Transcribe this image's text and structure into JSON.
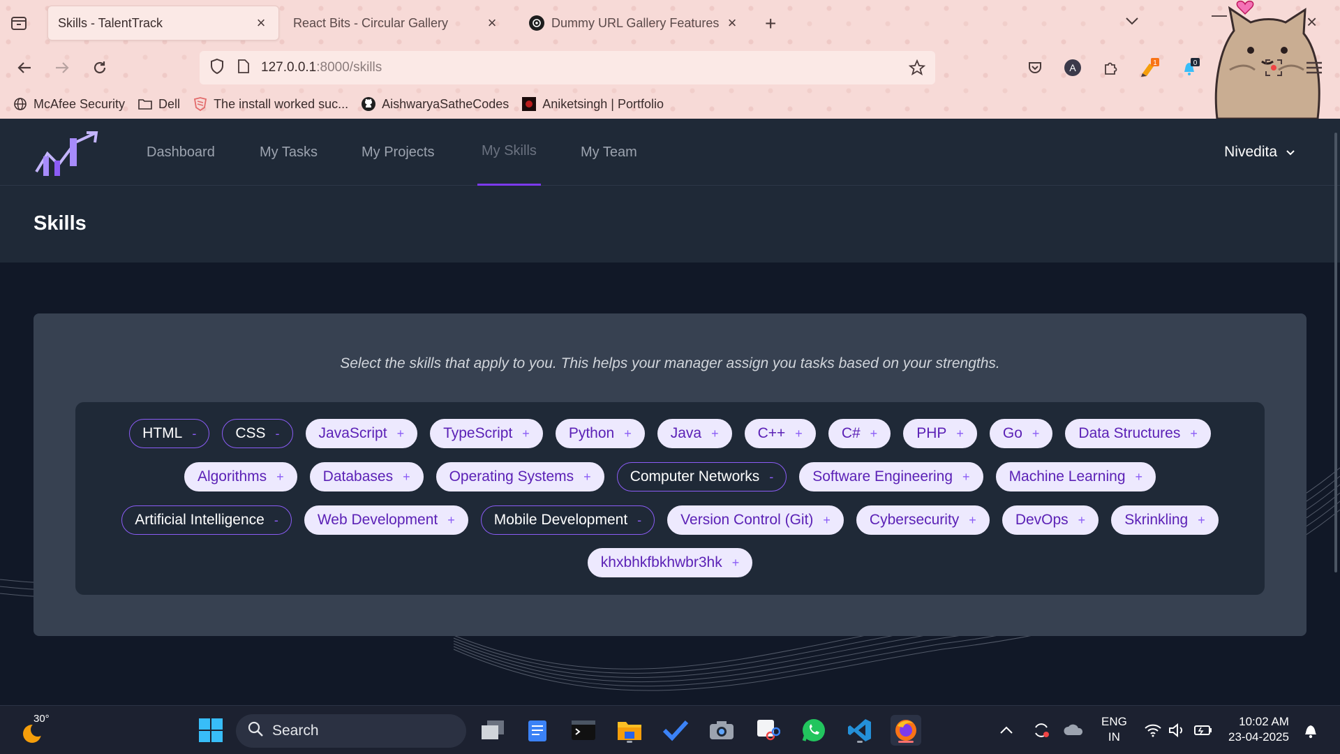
{
  "browser": {
    "tabs": [
      {
        "title": "Skills - TalentTrack",
        "active": true
      },
      {
        "title": "React Bits - Circular Gallery",
        "active": false
      },
      {
        "title": "Dummy URL Gallery Features",
        "active": false
      }
    ],
    "url_host": "127.0.0.1",
    "url_path": ":8000/skills",
    "extensions": [
      {
        "icon": "pocket-icon"
      },
      {
        "icon": "account-a-icon",
        "label": "A"
      },
      {
        "icon": "extensions-icon"
      },
      {
        "icon": "highlighter-icon",
        "badge": "1"
      },
      {
        "icon": "notification-extension-icon",
        "badge": "0"
      },
      {
        "icon": "ublock-icon"
      },
      {
        "icon": "screenshot-icon"
      },
      {
        "icon": "menu-icon"
      }
    ],
    "bookmarks": [
      {
        "label": "McAfee Security",
        "icon": "globe-icon"
      },
      {
        "label": "Dell",
        "icon": "folder-icon"
      },
      {
        "label": "The install worked suc...",
        "icon": "django-icon"
      },
      {
        "label": "AishwaryaSatheCodes",
        "icon": "github-icon"
      },
      {
        "label": "Aniketsingh | Portfolio",
        "icon": "portfolio-icon"
      }
    ]
  },
  "app": {
    "nav": [
      {
        "label": "Dashboard",
        "active": false
      },
      {
        "label": "My Tasks",
        "active": false
      },
      {
        "label": "My Projects",
        "active": false
      },
      {
        "label": "My Skills",
        "active": true
      },
      {
        "label": "My Team",
        "active": false
      }
    ],
    "user": "Nivedita",
    "page_title": "Skills",
    "intro": "Select the skills that apply to you. This helps your manager assign you tasks based on your strengths.",
    "skill_rows": [
      [
        {
          "name": "HTML",
          "selected": true
        },
        {
          "name": "CSS",
          "selected": true
        },
        {
          "name": "JavaScript",
          "selected": false
        },
        {
          "name": "TypeScript",
          "selected": false
        },
        {
          "name": "Python",
          "selected": false
        },
        {
          "name": "Java",
          "selected": false
        },
        {
          "name": "C++",
          "selected": false
        },
        {
          "name": "C#",
          "selected": false
        },
        {
          "name": "PHP",
          "selected": false
        },
        {
          "name": "Go",
          "selected": false
        },
        {
          "name": "Data Structures",
          "selected": false
        }
      ],
      [
        {
          "name": "Algorithms",
          "selected": false
        },
        {
          "name": "Databases",
          "selected": false
        },
        {
          "name": "Operating Systems",
          "selected": false
        },
        {
          "name": "Computer Networks",
          "selected": true
        },
        {
          "name": "Software Engineering",
          "selected": false
        },
        {
          "name": "Machine Learning",
          "selected": false
        }
      ],
      [
        {
          "name": "Artificial Intelligence",
          "selected": true
        },
        {
          "name": "Web Development",
          "selected": false
        },
        {
          "name": "Mobile Development",
          "selected": true
        },
        {
          "name": "Version Control (Git)",
          "selected": false
        },
        {
          "name": "Cybersecurity",
          "selected": false
        },
        {
          "name": "DevOps",
          "selected": false
        },
        {
          "name": "Skrinkling",
          "selected": false
        }
      ],
      [
        {
          "name": "khxbhkfbkhwbr3hk",
          "selected": false
        }
      ]
    ],
    "add_symbol": "+",
    "remove_symbol": "-",
    "colors": {
      "accent": "#8b5cf6",
      "chip_bg": "#ede9fe",
      "chip_text": "#5b21b6",
      "card": "#374151"
    }
  },
  "taskbar": {
    "temperature": "30°",
    "search_placeholder": "Search",
    "apps": [
      {
        "icon": "start-icon"
      },
      {
        "icon": "task-view-icon"
      },
      {
        "icon": "notepad-icon"
      },
      {
        "icon": "terminal-icon"
      },
      {
        "icon": "file-explorer-icon",
        "running": true
      },
      {
        "icon": "todo-icon"
      },
      {
        "icon": "camera-icon"
      },
      {
        "icon": "snipping-tool-icon"
      },
      {
        "icon": "whatsapp-icon"
      },
      {
        "icon": "vscode-icon",
        "running": true
      },
      {
        "icon": "firefox-icon",
        "running": true,
        "active": true
      }
    ],
    "language": "ENG",
    "region": "IN",
    "time": "10:02 AM",
    "date": "23-04-2025"
  }
}
